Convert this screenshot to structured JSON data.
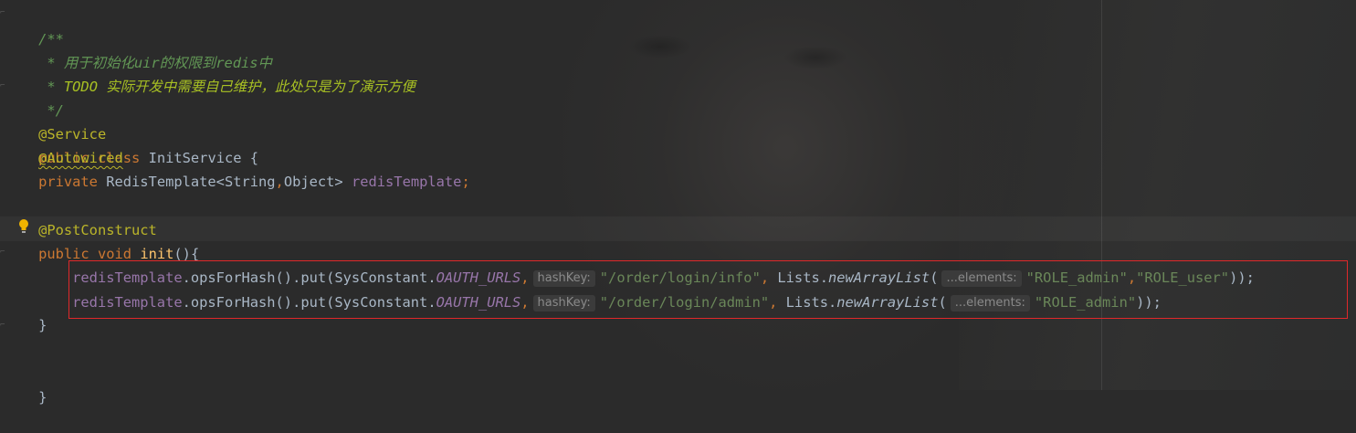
{
  "editor": {
    "line_comment_open": "/**",
    "line_comment_1_prefix": " * ",
    "line_comment_1": "用于初始化uir的权限到redis中",
    "line_comment_2_prefix": " * ",
    "line_comment_2_todo": "TODO",
    "line_comment_2": " 实际开发中需要自己维护，此处只是为了演示方便",
    "line_comment_close": " */",
    "service_annotation": "@Service",
    "kw_public": "public",
    "kw_class": "class",
    "class_decl": " InitService {",
    "autowired_annotation": "@Autowired",
    "kw_private": "private",
    "field_type": " RedisTemplate<String",
    "field_type_comma": ",",
    "field_type_rest": "Object> ",
    "field_name": "redisTemplate",
    "field_semicolon": ";",
    "postconstruct_annotation": "@PostConstruct",
    "kw_public2": "public",
    "kw_void": "void",
    "method_name": "init",
    "method_rest": "(){",
    "call_field": "redisTemplate",
    "call_chain": ".opsForHash().put(SysConstant.",
    "const_name": "OAUTH_URLS",
    "comma": ",",
    "hint_hashkey": "hashKey:",
    "line1_key": "\"/order/login/info\"",
    "line2_key": "\"/order/login/admin\"",
    "lists_prefix": " Lists.",
    "static_method": "newArrayList",
    "open_paren": "(",
    "hint_elements": "...elements:",
    "role_admin": "\"ROLE_admin\"",
    "role_user": "\"ROLE_user\"",
    "line1_close": "));",
    "line2_close": "));",
    "method_close": "}",
    "class_close": "}"
  },
  "colors": {
    "background": "#2b2b2b",
    "keyword": "#cc7832",
    "annotation": "#bbb529",
    "comment": "#629755",
    "field": "#9876aa",
    "string": "#6a8759",
    "method_decl": "#ffc66d",
    "highlight_box": "#e0282a"
  },
  "icons": {
    "intention_bulb": "lightbulb-icon"
  }
}
